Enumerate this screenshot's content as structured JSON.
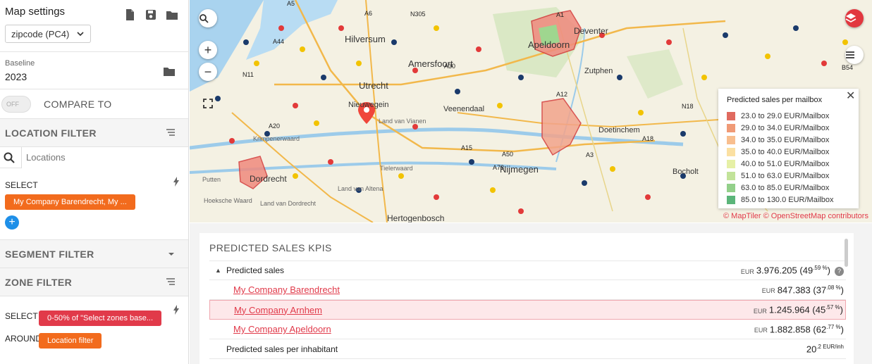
{
  "sidebar": {
    "settings": {
      "title": "Map settings",
      "zip_select": "zipcode (PC4)"
    },
    "baseline": {
      "label": "Baseline",
      "value": "2023"
    },
    "compare": {
      "toggle_state": "OFF",
      "label": "COMPARE TO"
    },
    "location_filter": {
      "title": "LOCATION FILTER",
      "search_placeholder": "Locations",
      "select_label": "SELECT",
      "chip": "My Company Barendrecht, My ..."
    },
    "segment_filter": {
      "title": "SEGMENT FILTER"
    },
    "zone_filter": {
      "title": "ZONE FILTER",
      "select_label": "SELECT",
      "select_chip": "0-50% of \"Select zones base...",
      "around_label": "AROUND",
      "around_chip": "Location filter"
    }
  },
  "map": {
    "places": [
      "Hilversum",
      "Amersfoort",
      "Apeldoorn",
      "Deventer",
      "Utrecht",
      "Nieuwegein",
      "Veenendaal",
      "Zutphen",
      "Nijmegen",
      "Dordrecht",
      "Doetinchem",
      "Bocholt",
      "Tielerwaard",
      "Land van Altena",
      "Hertogenbosch",
      "Land van Vianen",
      "Krimpenerwaard",
      "Hoeksche Waard",
      "Land van Dordrecht",
      "Putten"
    ],
    "roads": [
      "A5",
      "A6",
      "N305",
      "A44",
      "A30",
      "A1",
      "N11",
      "A12",
      "A20",
      "A15",
      "A50",
      "A73",
      "A18",
      "A3",
      "N18",
      "B54"
    ],
    "legend": {
      "title": "Predicted sales per mailbox",
      "items": [
        {
          "label": "23.0 to 29.0 EUR/Mailbox",
          "color": "#e06a5f"
        },
        {
          "label": "29.0 to 34.0 EUR/Mailbox",
          "color": "#f09a76"
        },
        {
          "label": "34.0 to 35.0 EUR/Mailbox",
          "color": "#f8be8e"
        },
        {
          "label": "35.0 to 40.0 EUR/Mailbox",
          "color": "#fbe0a2"
        },
        {
          "label": "40.0 to 51.0 EUR/Mailbox",
          "color": "#e6f0a6"
        },
        {
          "label": "51.0 to 63.0 EUR/Mailbox",
          "color": "#c2e39a"
        },
        {
          "label": "63.0 to 85.0 EUR/Mailbox",
          "color": "#93d08a"
        },
        {
          "label": "85.0 to 130.0 EUR/Mailbox",
          "color": "#5bb57a"
        }
      ]
    },
    "attribution": "© MapTiler © OpenStreetMap contributors"
  },
  "kpi": {
    "title": "PREDICTED SALES KPIS",
    "rows": [
      {
        "label": "Predicted sales",
        "cur": "EUR",
        "val": "3.976.205",
        "pct_main": "49",
        "pct_sup": ".59 %"
      },
      {
        "label": "My Company Barendrecht",
        "cur": "EUR",
        "val": "847.383",
        "pct_main": "37",
        "pct_sup": ".08 %"
      },
      {
        "label": "My Company Arnhem",
        "cur": "EUR",
        "val": "1.245.964",
        "pct_main": "45",
        "pct_sup": ".57 %"
      },
      {
        "label": "My Company Apeldoorn",
        "cur": "EUR",
        "val": "1.882.858",
        "pct_main": "62",
        "pct_sup": ".77 %"
      },
      {
        "label": "Predicted sales per inhabitant",
        "val_main": "20",
        "val_sup": ".2 EUR/inh"
      }
    ]
  }
}
